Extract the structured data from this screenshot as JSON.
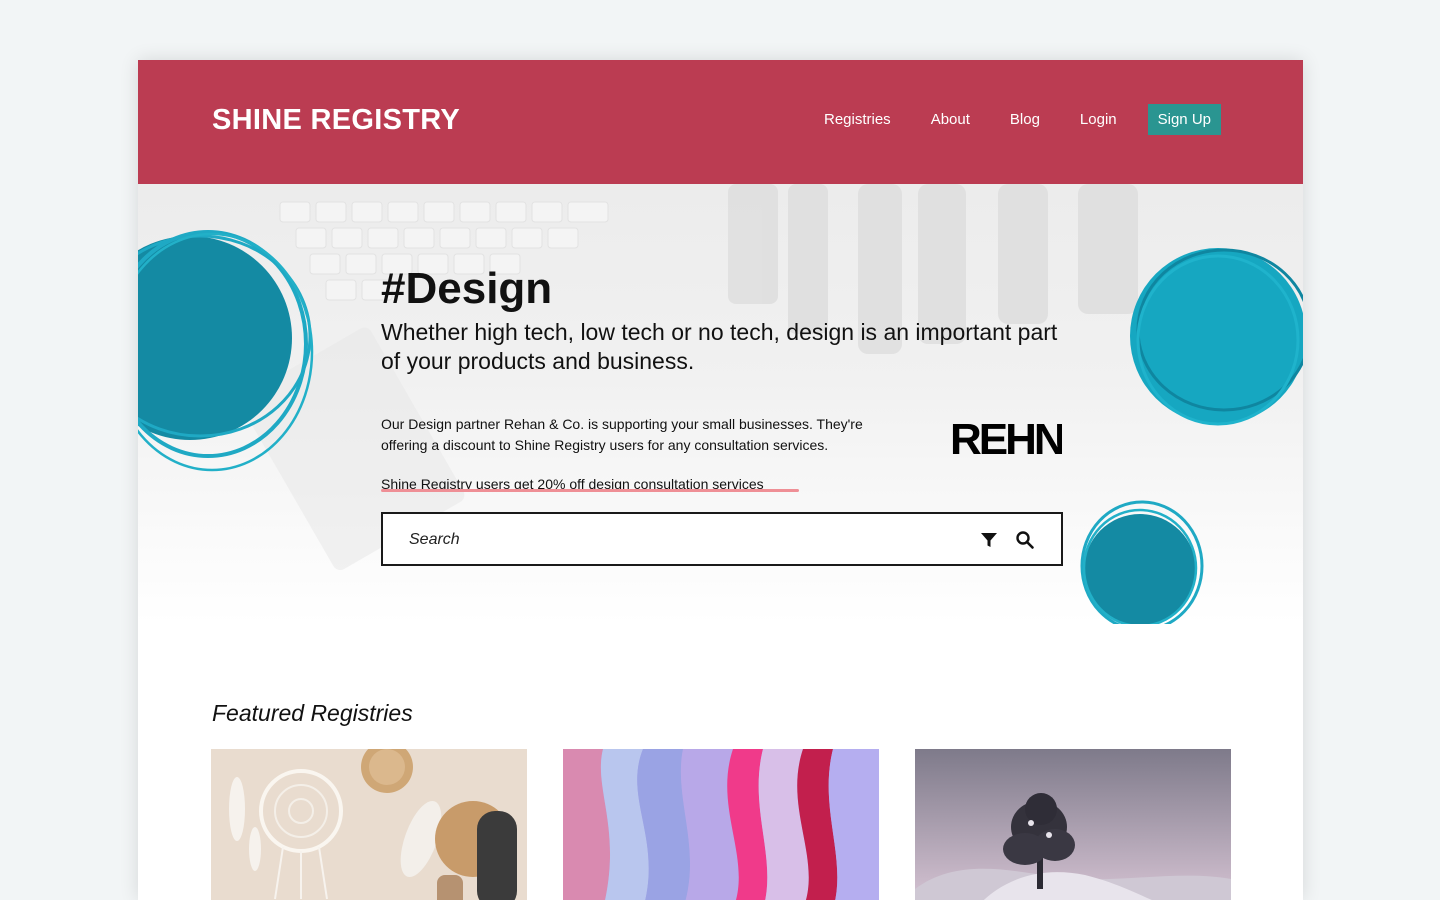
{
  "header": {
    "logo": "SHINE REGISTRY",
    "nav": [
      "Registries",
      "About",
      "Blog",
      "Login"
    ],
    "signup_label": "Sign Up"
  },
  "hero": {
    "title": "#Design",
    "subtitle": "Whether high tech, low tech or no tech, design is an important part of your products and business.",
    "body": "Our Design partner Rehan & Co. is supporting your small businesses. They're offering a discount to Shine Registry users for any consultation services.",
    "promo": "Shine Registry users get 20% off design consultation services",
    "partner_logo_text": "REHN"
  },
  "search": {
    "placeholder": "Search",
    "filter_icon": "filter-icon",
    "search_icon": "magnifier-icon"
  },
  "featured": {
    "title": "Featured Registries",
    "cards": [
      "dreamcatcher-decor",
      "abstract-fluid-art",
      "snowy-tree-landscape"
    ]
  },
  "colors": {
    "header_bg": "#bb3c52",
    "signup_bg": "#2a9591",
    "accent_teal": "#1fa9c4",
    "promo_underline": "#ef8f96"
  }
}
